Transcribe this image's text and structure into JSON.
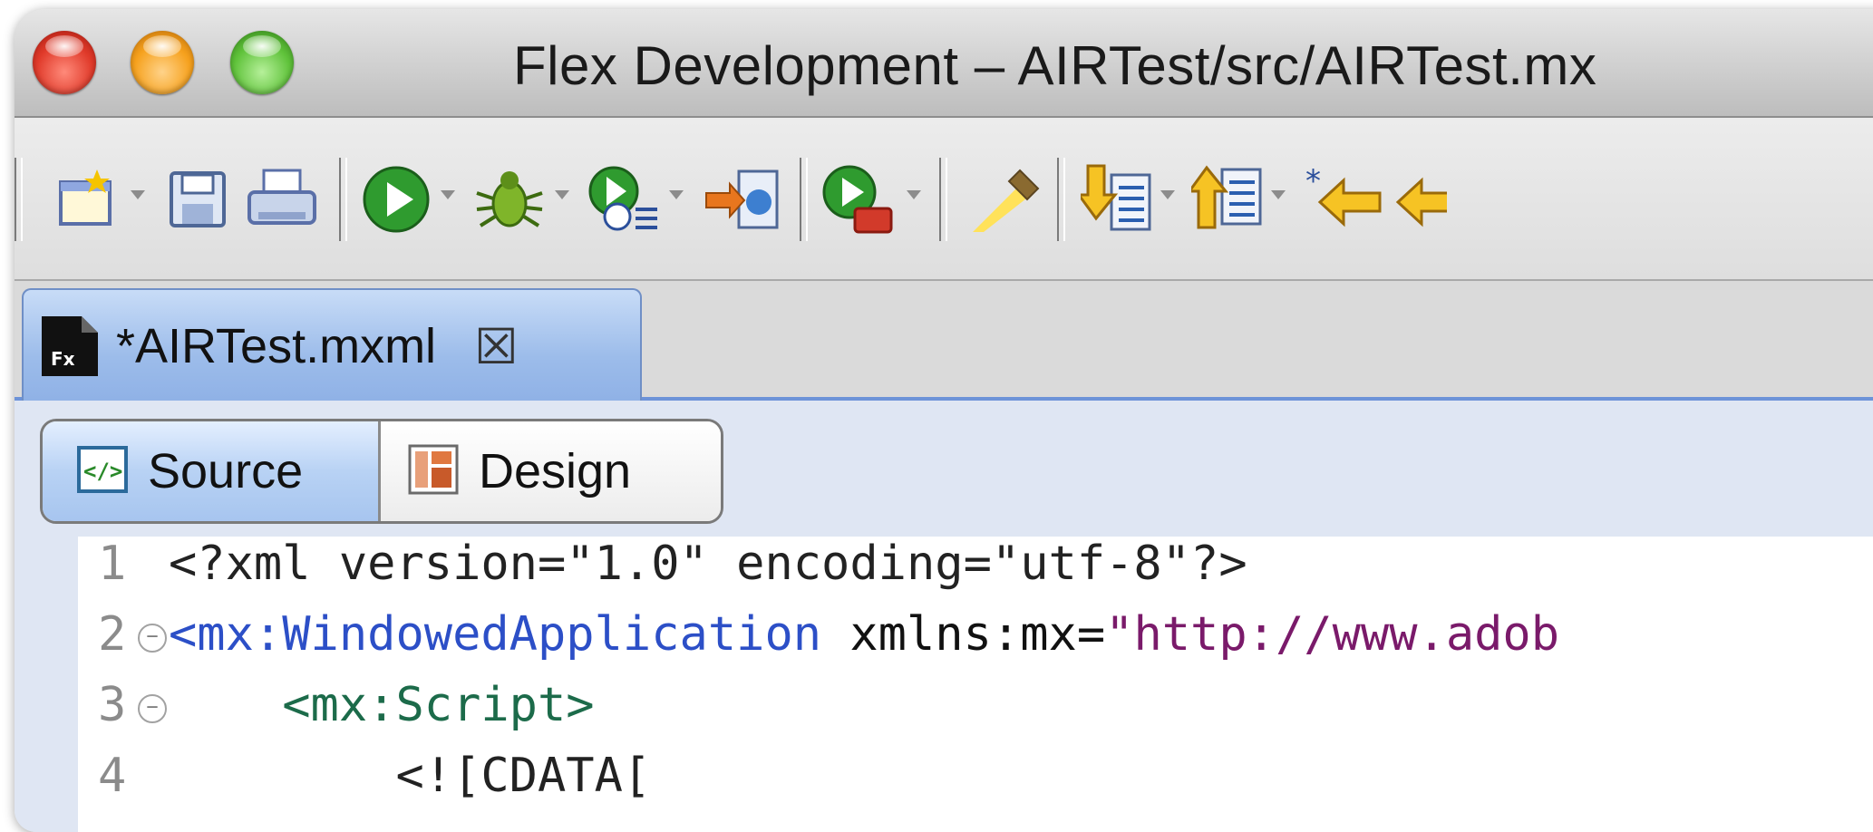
{
  "window": {
    "title": "Flex Development – AIRTest/src/AIRTest.mx"
  },
  "toolbar": {
    "items": [
      {
        "icon": "new-project-icon",
        "has_dropdown": true
      },
      {
        "icon": "save-icon"
      },
      {
        "icon": "print-icon"
      },
      {
        "icon": "run-icon",
        "has_dropdown": true
      },
      {
        "icon": "debug-icon",
        "has_dropdown": true
      },
      {
        "icon": "profile-icon",
        "has_dropdown": true
      },
      {
        "icon": "export-release-icon"
      },
      {
        "icon": "run-external-tools-icon",
        "has_dropdown": true
      },
      {
        "icon": "highlighter-icon"
      },
      {
        "icon": "next-annotation-icon",
        "has_dropdown": true
      },
      {
        "icon": "previous-annotation-icon",
        "has_dropdown": true
      },
      {
        "icon": "last-edit-location-icon"
      },
      {
        "icon": "back-icon"
      }
    ]
  },
  "editor": {
    "tab_label": "*AIRTest.mxml",
    "tab_file_icon_text": "Fx",
    "view_switch": {
      "source_label": "Source",
      "design_label": "Design",
      "selected": "Source"
    },
    "code_lines": [
      {
        "num": "1",
        "fold": false,
        "parts": [
          {
            "text": "<?xml version=\"1.0\" encoding=\"utf-8\"?>",
            "cls": "c-pi"
          }
        ]
      },
      {
        "num": "2",
        "fold": true,
        "parts": [
          {
            "text": "<mx:WindowedApplication",
            "cls": "c-tag"
          },
          {
            "text": " xmlns:mx=",
            "cls": "c-attr"
          },
          {
            "text": "\"http://www.adob",
            "cls": "c-val"
          }
        ]
      },
      {
        "num": "3",
        "fold": true,
        "parts": [
          {
            "text": "    <mx:Script>",
            "cls": "c-green"
          }
        ]
      },
      {
        "num": "4",
        "fold": false,
        "parts": [
          {
            "text": "        <![CDATA[",
            "cls": "c-pi"
          }
        ]
      }
    ]
  },
  "colors": {
    "tab_active": "#9cbcea",
    "tag_blue": "#2c4fc7",
    "string_purple": "#7a1a6a",
    "script_green": "#1c6b4a"
  }
}
